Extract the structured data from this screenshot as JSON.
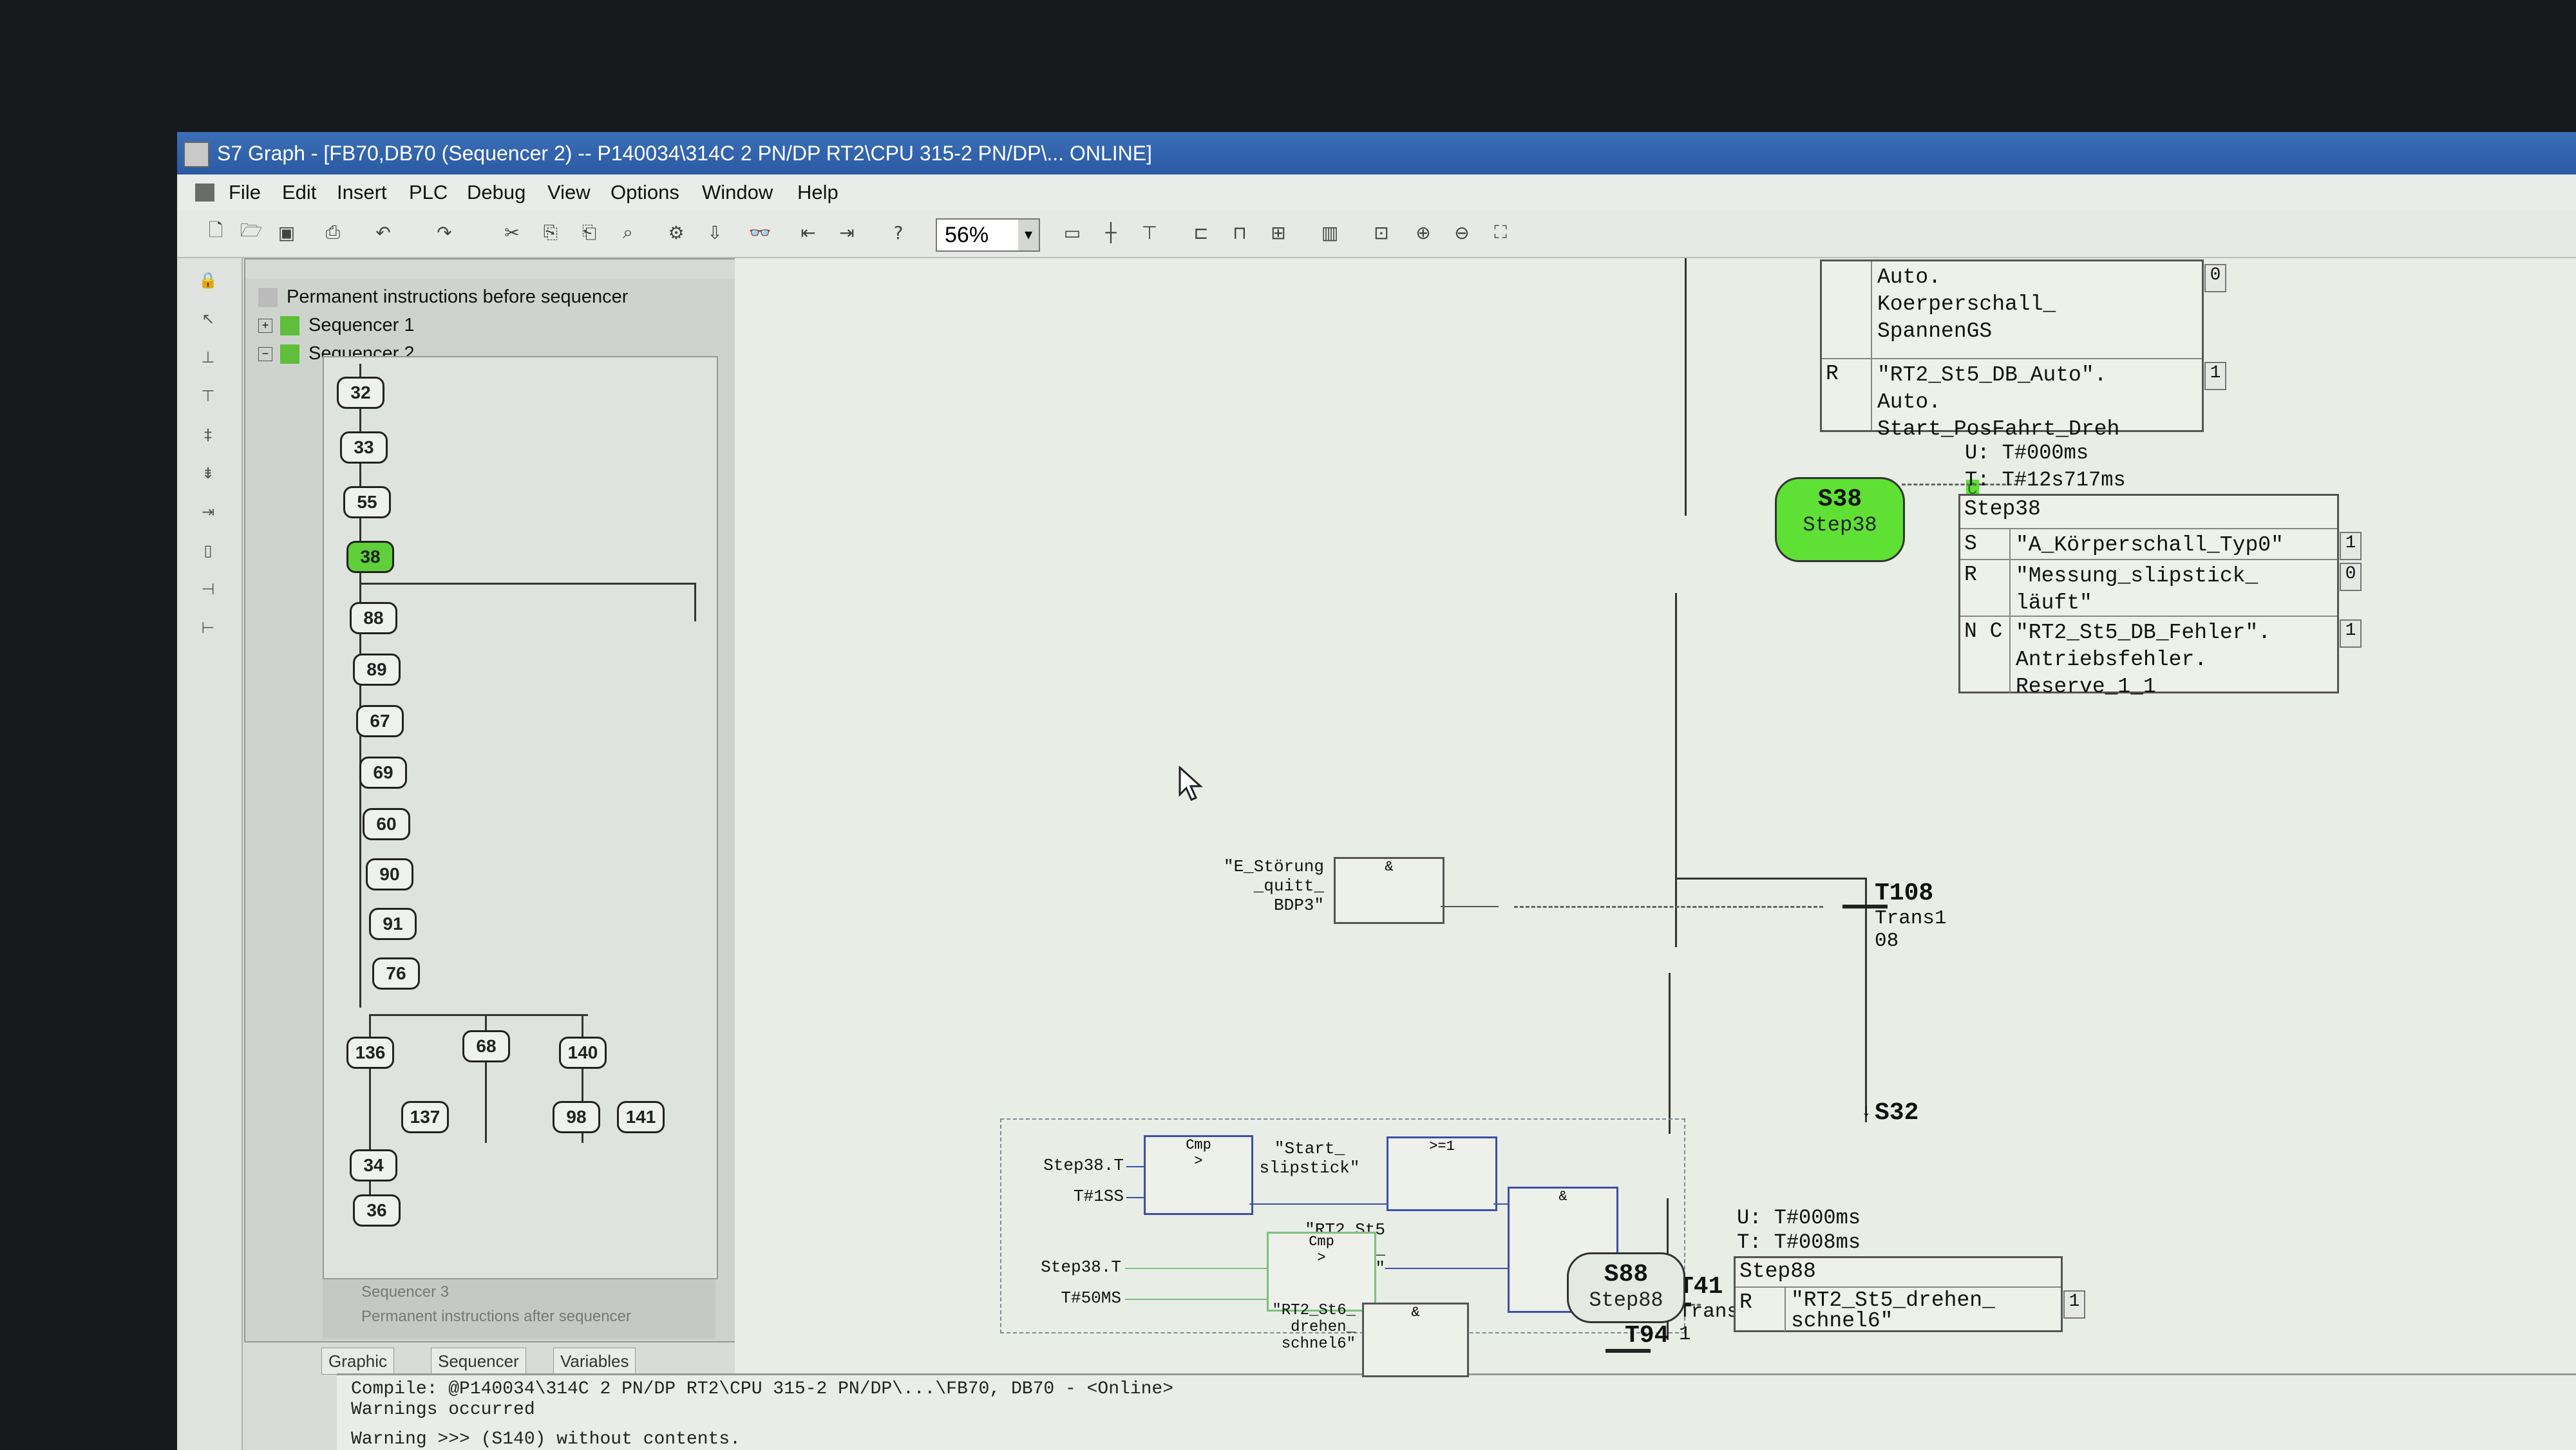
{
  "window": {
    "title": "S7 Graph - [FB70,DB70 (Sequencer 2) -- P140034\\314C 2 PN/DP RT2\\CPU 315-2 PN/DP\\... ONLINE]"
  },
  "menu": [
    "File",
    "Edit",
    "Insert",
    "PLC",
    "Debug",
    "View",
    "Options",
    "Window",
    "Help"
  ],
  "toolbar": {
    "zoom": "56%"
  },
  "overview": {
    "tree": [
      {
        "label": "Permanent instructions before sequencer"
      },
      {
        "label": "Sequencer 1"
      },
      {
        "label": "Sequencer 2"
      }
    ],
    "dimmed": [
      "Sequencer 3",
      "Permanent instructions after sequencer"
    ],
    "mini_steps": [
      "32",
      "33",
      "55",
      "38",
      "88",
      "89",
      "67",
      "69",
      "60",
      "90",
      "91",
      "76",
      "136",
      "68",
      "140",
      "137",
      "98",
      "141",
      "34",
      "36"
    ],
    "tabs": [
      "Graphic",
      "Sequencer",
      "Variables"
    ]
  },
  "steps": {
    "s38": {
      "num": "S38",
      "name": "Step38",
      "status": "active",
      "flag": "C",
      "u": "U: T#000ms",
      "t": "T: T#12s717ms"
    },
    "s88": {
      "num": "S88",
      "name": "Step88",
      "u": "U: T#000ms",
      "t": "T: T#008ms"
    }
  },
  "actions_top": [
    {
      "q": "",
      "text": "Auto.\nKoerperschall_\nSpannenGS",
      "v": "0"
    },
    {
      "q": "R",
      "text": "\"RT2_St5_DB_Auto\".\nAuto.\nStart_PosFahrt_Dreh",
      "v": "1"
    }
  ],
  "actions_s38": {
    "head": "Step38",
    "rows": [
      {
        "q": "S",
        "text": "\"A_Körperschall_Typ0\"",
        "v": "1"
      },
      {
        "q": "R",
        "text": "\"Messung_slipstick_\nläuft\"",
        "v": "0"
      },
      {
        "q": "N C",
        "text": "\"RT2_St5_DB_Fehler\".\nAntriebsfehler.\nReserve_1_1",
        "v": "1"
      }
    ]
  },
  "actions_s88": {
    "head": "Step88",
    "rows": [
      {
        "q": "R",
        "text": "\"RT2_St5_drehen_\nschnel6\"",
        "v": "1"
      }
    ]
  },
  "transitions": {
    "t108": {
      "name": "T108",
      "label": "Trans1",
      "sub": "08",
      "target": "S32"
    },
    "t41": {
      "name": "T41",
      "label": "Trans4",
      "sub": "1"
    },
    "t94": {
      "name": "T94"
    }
  },
  "logic": {
    "t108_input": "\"E_Störung\n_quitt_\nBDP3\"",
    "and_sym": "&",
    "or_sym": ">=1",
    "cmp": "Cmp",
    "cmp_op": ">",
    "cmp1_in1": "Step38.T",
    "cmp1_in2": "T#1SS",
    "cmp2_in1": "Step38.T",
    "cmp2_in2": "T#50MS",
    "start_slip": "\"Start_\nslipstick\"",
    "cmd_move": "\"RT2_St5\nCMMD_\nBewegung\"",
    "t94_input": "\"RT2_St6_\ndrehen_\nschnel6\""
  },
  "output": {
    "lines": [
      "Compile: @P140034\\314C 2 PN/DP RT2\\CPU 315-2 PN/DP\\...\\FB70, DB70 - <Online>",
      "Warnings occurred",
      "Warning >>> (S140)  without contents."
    ]
  },
  "colors": {
    "active_step": "#5ee034",
    "canvas": "#e8ede6",
    "titlebar": "#2a5aa3"
  }
}
